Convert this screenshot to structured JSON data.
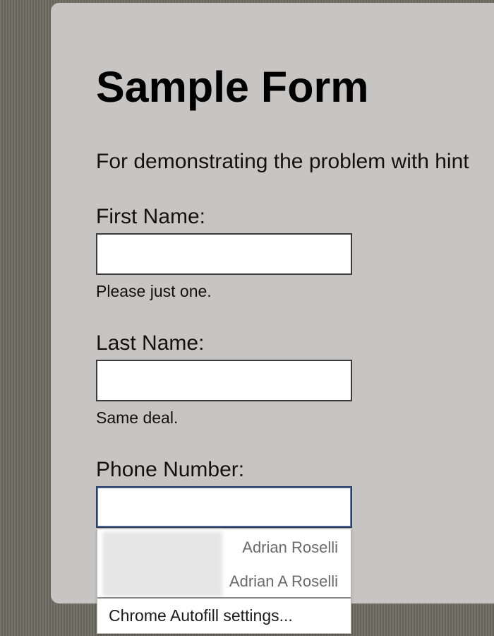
{
  "form": {
    "title": "Sample Form",
    "intro": "For demonstrating the problem with hint",
    "fields": [
      {
        "label": "First Name:",
        "value": "",
        "hint": "Please just one."
      },
      {
        "label": "Last Name:",
        "value": "",
        "hint": "Same deal."
      },
      {
        "label": "Phone Number:",
        "value": ""
      }
    ]
  },
  "autofill": {
    "suggestions": [
      "Adrian Roselli",
      "Adrian A Roselli"
    ],
    "settings_label": "Chrome Autofill settings..."
  },
  "colors": {
    "page_background": "#6f6e63",
    "card_background": "#c6c5c3",
    "focus_border": "#2a3f66"
  }
}
